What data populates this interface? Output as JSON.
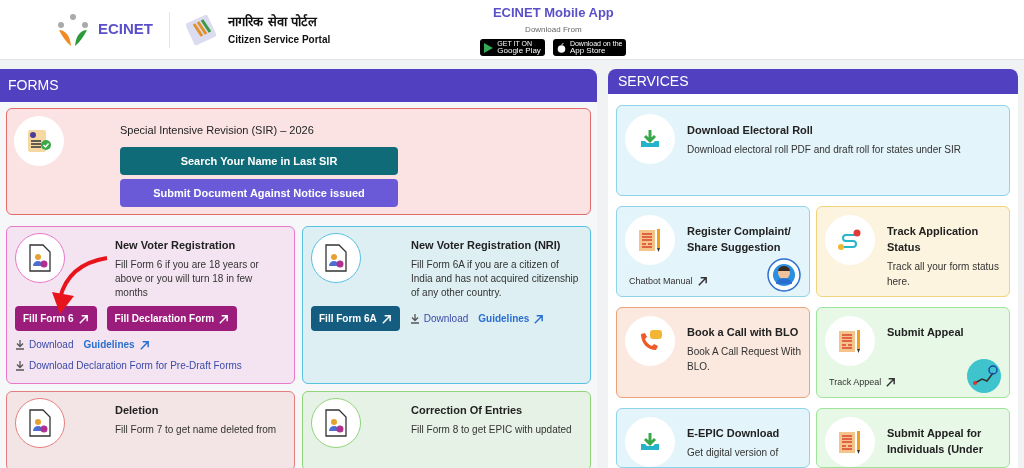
{
  "header": {
    "logo_text": "ECINET",
    "portal_title_hindi": "नागरिक सेवा पोर्टल",
    "portal_title_english": "Citizen Service Portal",
    "app": {
      "title": "ECINET Mobile App",
      "subtitle": "Download From",
      "stores": [
        {
          "kind": "google",
          "small": "GET IT ON",
          "label": "Google Play"
        },
        {
          "kind": "apple",
          "small": "Download on the",
          "label": "App Store"
        }
      ]
    }
  },
  "forms": {
    "title": "FORMS",
    "sir": {
      "title": "Special Intensive Revision (SIR) – 2026",
      "buttons": [
        {
          "label": "Search Your Name in Last SIR",
          "color": "#0f6b78"
        },
        {
          "label": "Submit Document Against Notice issued",
          "color": "#6a5ad8"
        }
      ]
    },
    "cards": [
      {
        "title": "New Voter Registration",
        "description": "Fill Form 6 if you are 18 years or above or you will turn 18 in few months",
        "color": "#e879c9",
        "actions": [
          {
            "kind": "primary",
            "label": "Fill Form 6",
            "color": "#9c1c7c"
          },
          {
            "kind": "primary",
            "label": "Fill Declaration Form",
            "color": "#9c1c7c"
          },
          {
            "kind": "download",
            "label": "Download"
          },
          {
            "kind": "link",
            "label": "Guidelines"
          },
          {
            "kind": "download",
            "label": "Download Declaration Form for Pre-Draft Forms"
          }
        ]
      },
      {
        "title": "New Voter Registration (NRI)",
        "description": "Fill Form 6A if you are a citizen of India and has not acquired citizenship of any other country.",
        "color": "#56c1e0",
        "actions": [
          {
            "kind": "primary",
            "label": "Fill Form 6A",
            "color": "#145d80"
          },
          {
            "kind": "download",
            "label": "Download"
          },
          {
            "kind": "link",
            "label": "Guidelines"
          }
        ]
      },
      {
        "title": "Deletion",
        "description": "Fill Form 7 to get name deleted from",
        "color": "#e57f7f"
      },
      {
        "title": "Correction Of Entries",
        "description": "Fill Form 8 to get EPIC with updated",
        "color": "#8fd47a"
      }
    ]
  },
  "services": {
    "title": "SERVICES",
    "cards": [
      {
        "kind": "download",
        "title": "Download Electoral Roll",
        "description": "Download electoral roll PDF and draft roll for states under SIR",
        "color": "#8fd3ea"
      },
      {
        "kind": "complaint",
        "title": "Register Complaint/ Share Suggestion",
        "link": "Chatbot Manual",
        "badge": {
          "kind": "chatbot"
        },
        "color": "#8fd3ea"
      },
      {
        "kind": "track",
        "title": "Track Application Status",
        "description": "Track all your form status here.",
        "color": "#f2d27a"
      },
      {
        "kind": "call",
        "title": "Book a Call with BLO",
        "description": "Book A Call Request With BLO.",
        "color": "#eea27a"
      },
      {
        "kind": "complaint",
        "title": "Submit Appeal",
        "link": "Track Appeal",
        "badge": {
          "kind": "route"
        },
        "color": "#9ee39a"
      },
      {
        "kind": "download",
        "title": "E-EPIC Download",
        "description": "Get digital version of",
        "color": "#8fd3ea"
      },
      {
        "kind": "complaint",
        "title": "Submit Appeal for Individuals (Under",
        "color": "#9ee39a"
      }
    ]
  }
}
